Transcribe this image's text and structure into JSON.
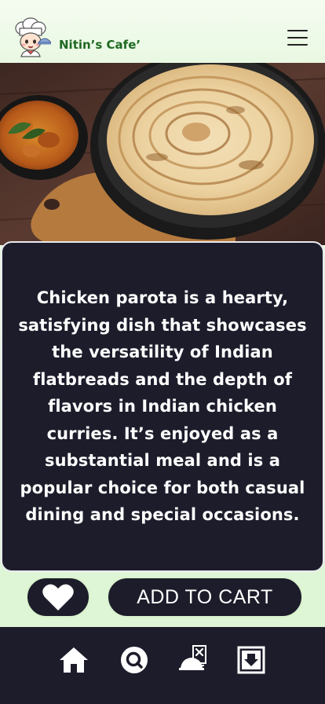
{
  "header": {
    "brand_name": "Nitin’s Cafe’",
    "logo_icon": "chef-mascot-logo",
    "menu_icon": "hamburger-menu-icon"
  },
  "hero": {
    "image_subject": "chicken-parotta-with-curry"
  },
  "description": {
    "text": "Chicken parota is a hearty, satisfying dish that showcases the versatility of Indian flatbreads and the depth of flavors in Indian chicken curries. It’s enjoyed as a substantial meal and is a popular choice for both casual dining and special occasions."
  },
  "actions": {
    "favorite_icon": "heart-icon",
    "add_to_cart_label": "ADD TO CART"
  },
  "bottom_nav": {
    "items": [
      {
        "icon": "home-icon"
      },
      {
        "icon": "search-icon"
      },
      {
        "icon": "chef-service-icon"
      },
      {
        "icon": "download-box-icon"
      }
    ]
  },
  "colors": {
    "dark_card": "#1c1c2b",
    "brand_green": "#1f6a22",
    "background_mint": "#e6f7de"
  }
}
